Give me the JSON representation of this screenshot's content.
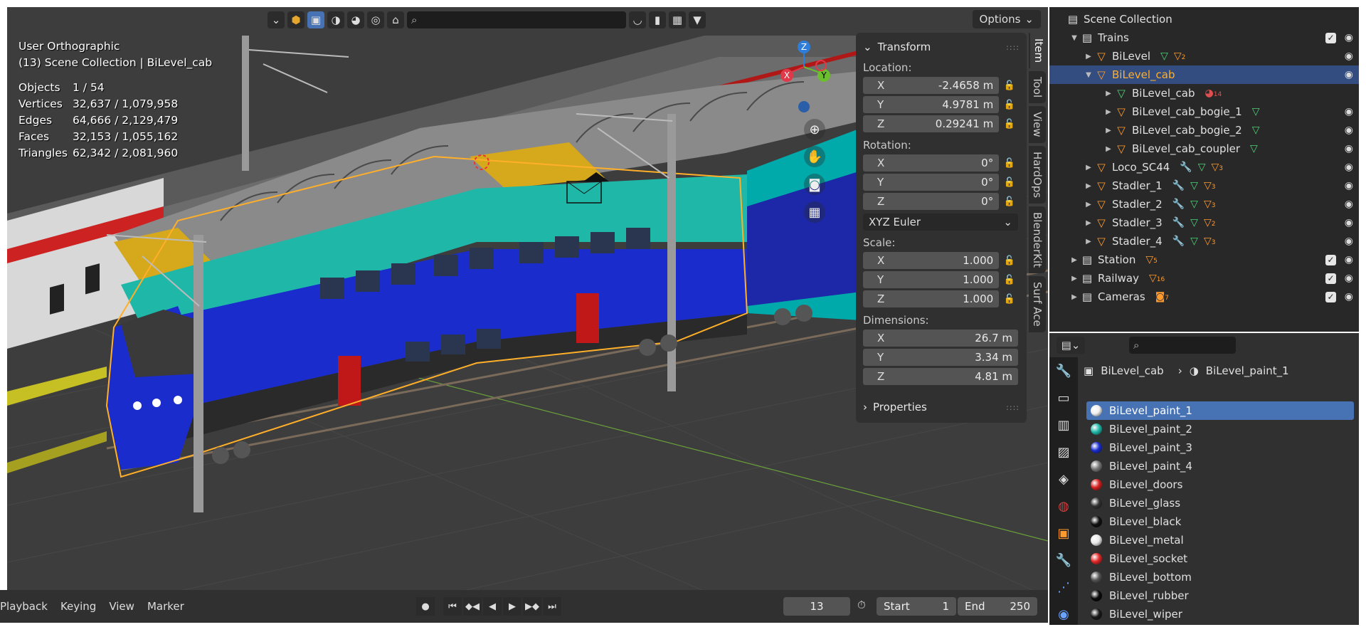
{
  "viewport": {
    "view_name": "User Orthographic",
    "collection_label": "(13) Scene Collection | BiLevel_cab",
    "stats": [
      {
        "label": "Objects",
        "value": "1 / 54"
      },
      {
        "label": "Vertices",
        "value": "32,637 / 1,079,958"
      },
      {
        "label": "Edges",
        "value": "64,666 / 2,129,479"
      },
      {
        "label": "Faces",
        "value": "32,153 / 1,055,162"
      },
      {
        "label": "Triangles",
        "value": "62,342 / 2,081,960"
      }
    ],
    "options_label": "Options",
    "gizmo": {
      "x": "X",
      "y": "Y",
      "z": "Z"
    }
  },
  "npanel": {
    "title": "Transform",
    "location_label": "Location:",
    "location": [
      {
        "axis": "X",
        "value": "-2.4658 m"
      },
      {
        "axis": "Y",
        "value": "4.9781 m"
      },
      {
        "axis": "Z",
        "value": "0.29241 m"
      }
    ],
    "rotation_label": "Rotation:",
    "rotation": [
      {
        "axis": "X",
        "value": "0°"
      },
      {
        "axis": "Y",
        "value": "0°"
      },
      {
        "axis": "Z",
        "value": "0°"
      }
    ],
    "rotation_mode": "XYZ Euler",
    "scale_label": "Scale:",
    "scale": [
      {
        "axis": "X",
        "value": "1.000"
      },
      {
        "axis": "Y",
        "value": "1.000"
      },
      {
        "axis": "Z",
        "value": "1.000"
      }
    ],
    "dimensions_label": "Dimensions:",
    "dimensions": [
      {
        "axis": "X",
        "value": "26.7 m"
      },
      {
        "axis": "Y",
        "value": "3.34 m"
      },
      {
        "axis": "Z",
        "value": "4.81 m"
      }
    ],
    "properties_label": "Properties"
  },
  "vtabs": [
    "Item",
    "Tool",
    "View",
    "HardOps",
    "BlenderKit",
    "Surf Ace"
  ],
  "timeline": {
    "menus": [
      "Playback",
      "Keying",
      "View",
      "Marker"
    ],
    "current_frame": "13",
    "start_label": "Start",
    "start_value": "1",
    "end_label": "End",
    "end_value": "250"
  },
  "outliner": {
    "root": "Scene Collection",
    "rows": [
      {
        "name": "Trains",
        "kind": "collection"
      },
      {
        "name": "BiLevel",
        "kind": "object",
        "mesh_count": "",
        "tri_count": "2"
      },
      {
        "name": "BiLevel_cab",
        "kind": "object-selected"
      },
      {
        "name": "BiLevel_cab",
        "kind": "mesh",
        "count": "14"
      },
      {
        "name": "BiLevel_cab_bogie_1",
        "kind": "child"
      },
      {
        "name": "BiLevel_cab_bogie_2",
        "kind": "child"
      },
      {
        "name": "BiLevel_cab_coupler",
        "kind": "child"
      },
      {
        "name": "Loco_SC44",
        "kind": "object",
        "tri_count": "3"
      },
      {
        "name": "Stadler_1",
        "kind": "object",
        "tri_count": "3"
      },
      {
        "name": "Stadler_2",
        "kind": "object",
        "tri_count": "3"
      },
      {
        "name": "Stadler_3",
        "kind": "object",
        "tri_count": "2"
      },
      {
        "name": "Stadler_4",
        "kind": "object",
        "tri_count": "3"
      },
      {
        "name": "Station",
        "kind": "collection",
        "tri_count": "5"
      },
      {
        "name": "Railway",
        "kind": "collection",
        "tri_count": "16"
      },
      {
        "name": "Cameras",
        "kind": "collection",
        "cam_count": "7"
      }
    ]
  },
  "properties": {
    "object_name": "BiLevel_cab",
    "material_name": "BiLevel_paint_1",
    "materials": [
      {
        "name": "BiLevel_paint_1",
        "color": "#f0f0f0"
      },
      {
        "name": "BiLevel_paint_2",
        "color": "#1fb8a8"
      },
      {
        "name": "BiLevel_paint_3",
        "color": "#1a2ccc"
      },
      {
        "name": "BiLevel_paint_4",
        "color": "#777777"
      },
      {
        "name": "BiLevel_doors",
        "color": "#d42020"
      },
      {
        "name": "BiLevel_glass",
        "color": "#333333"
      },
      {
        "name": "BiLevel_black",
        "color": "#111111"
      },
      {
        "name": "BiLevel_metal",
        "color": "#e8e8e8"
      },
      {
        "name": "BiLevel_socket",
        "color": "#e02828"
      },
      {
        "name": "BiLevel_bottom",
        "color": "#555555"
      },
      {
        "name": "BiLevel_rubber",
        "color": "#0a0a0a"
      },
      {
        "name": "BiLevel_wiper",
        "color": "#1a1a1a"
      }
    ]
  },
  "colors": {
    "accent": "#4772b3",
    "selection_orange": "#ffaf29",
    "viewport_bg": "#3d3d3d",
    "train_teal": "#1fb8a8",
    "train_blue": "#1a2ccc"
  }
}
